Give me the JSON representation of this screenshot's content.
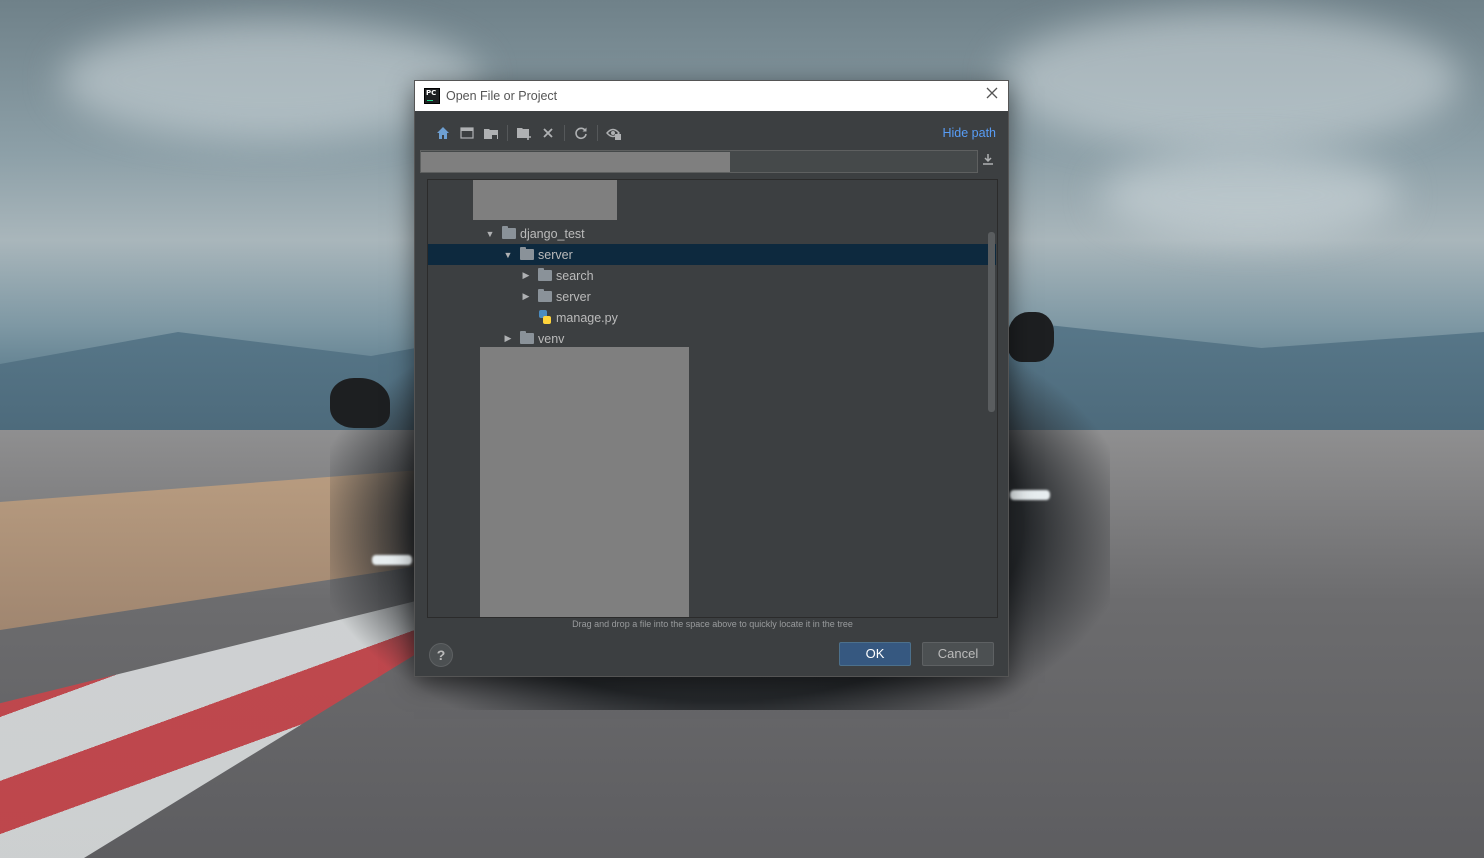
{
  "dialog": {
    "title": "Open File or Project",
    "hide_path_label": "Hide path",
    "hint": "Drag and drop a file into the space above to quickly locate it in the tree",
    "ok_label": "OK",
    "cancel_label": "Cancel",
    "help_label": "?"
  },
  "toolbar": {
    "icons": [
      "home-icon",
      "desktop-icon",
      "project-folder-icon",
      "new-folder-icon",
      "delete-icon",
      "refresh-icon",
      "show-hidden-icon"
    ]
  },
  "tree": {
    "items": [
      {
        "label": "django_test",
        "type": "folder",
        "expanded": true
      },
      {
        "label": "server",
        "type": "folder",
        "expanded": true,
        "selected": true
      },
      {
        "label": "search",
        "type": "folder",
        "expanded": false
      },
      {
        "label": "server",
        "type": "folder",
        "expanded": false
      },
      {
        "label": "manage.py",
        "type": "python-file"
      },
      {
        "label": "venv",
        "type": "folder",
        "expanded": false
      }
    ]
  },
  "colors": {
    "dialog_bg": "#3c3f41",
    "selection": "#0d293e",
    "link": "#589df6",
    "ok_button": "#365880"
  }
}
